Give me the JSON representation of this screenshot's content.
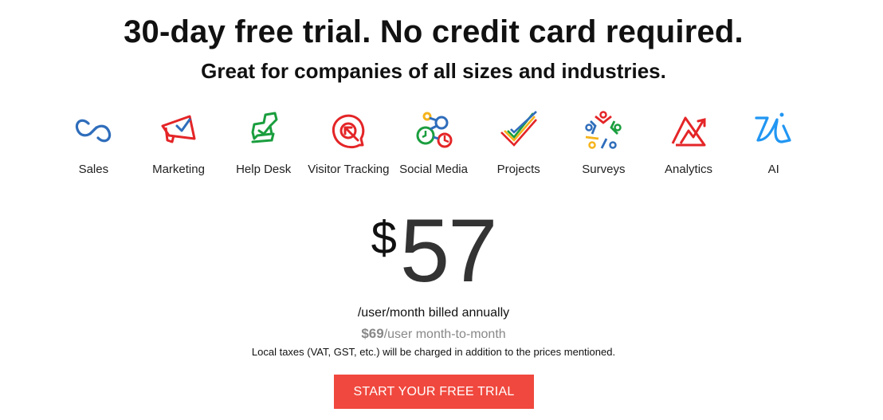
{
  "header": {
    "title": "30-day free trial. No credit card required.",
    "subtitle": "Great for companies of all sizes and industries."
  },
  "products": [
    {
      "label": "Sales",
      "icon": "sales-infinity-icon"
    },
    {
      "label": "Marketing",
      "icon": "marketing-megaphone-icon"
    },
    {
      "label": "Help Desk",
      "icon": "helpdesk-chat-icon"
    },
    {
      "label": "Visitor Tracking",
      "icon": "visitor-target-icon"
    },
    {
      "label": "Social Media",
      "icon": "social-nodes-icon"
    },
    {
      "label": "Projects",
      "icon": "projects-check-icon"
    },
    {
      "label": "Surveys",
      "icon": "surveys-people-icon"
    },
    {
      "label": "Analytics",
      "icon": "analytics-mountain-icon"
    },
    {
      "label": "AI",
      "icon": "ai-zia-icon"
    }
  ],
  "pricing": {
    "currency": "$",
    "amount": "57",
    "billing": "/user/month billed annually",
    "monthly_price": "$69",
    "monthly_suffix": "/user month-to-month",
    "taxes_note": "Local taxes (VAT, GST, etc.) will be charged in addition to the prices mentioned."
  },
  "cta": {
    "label": "START YOUR FREE TRIAL",
    "color": "#f0483e"
  },
  "colors": {
    "blue": "#2f6dbb",
    "red": "#e42527",
    "green": "#1a9e3e",
    "yellow": "#f5b31b",
    "light_blue": "#2196f3"
  }
}
